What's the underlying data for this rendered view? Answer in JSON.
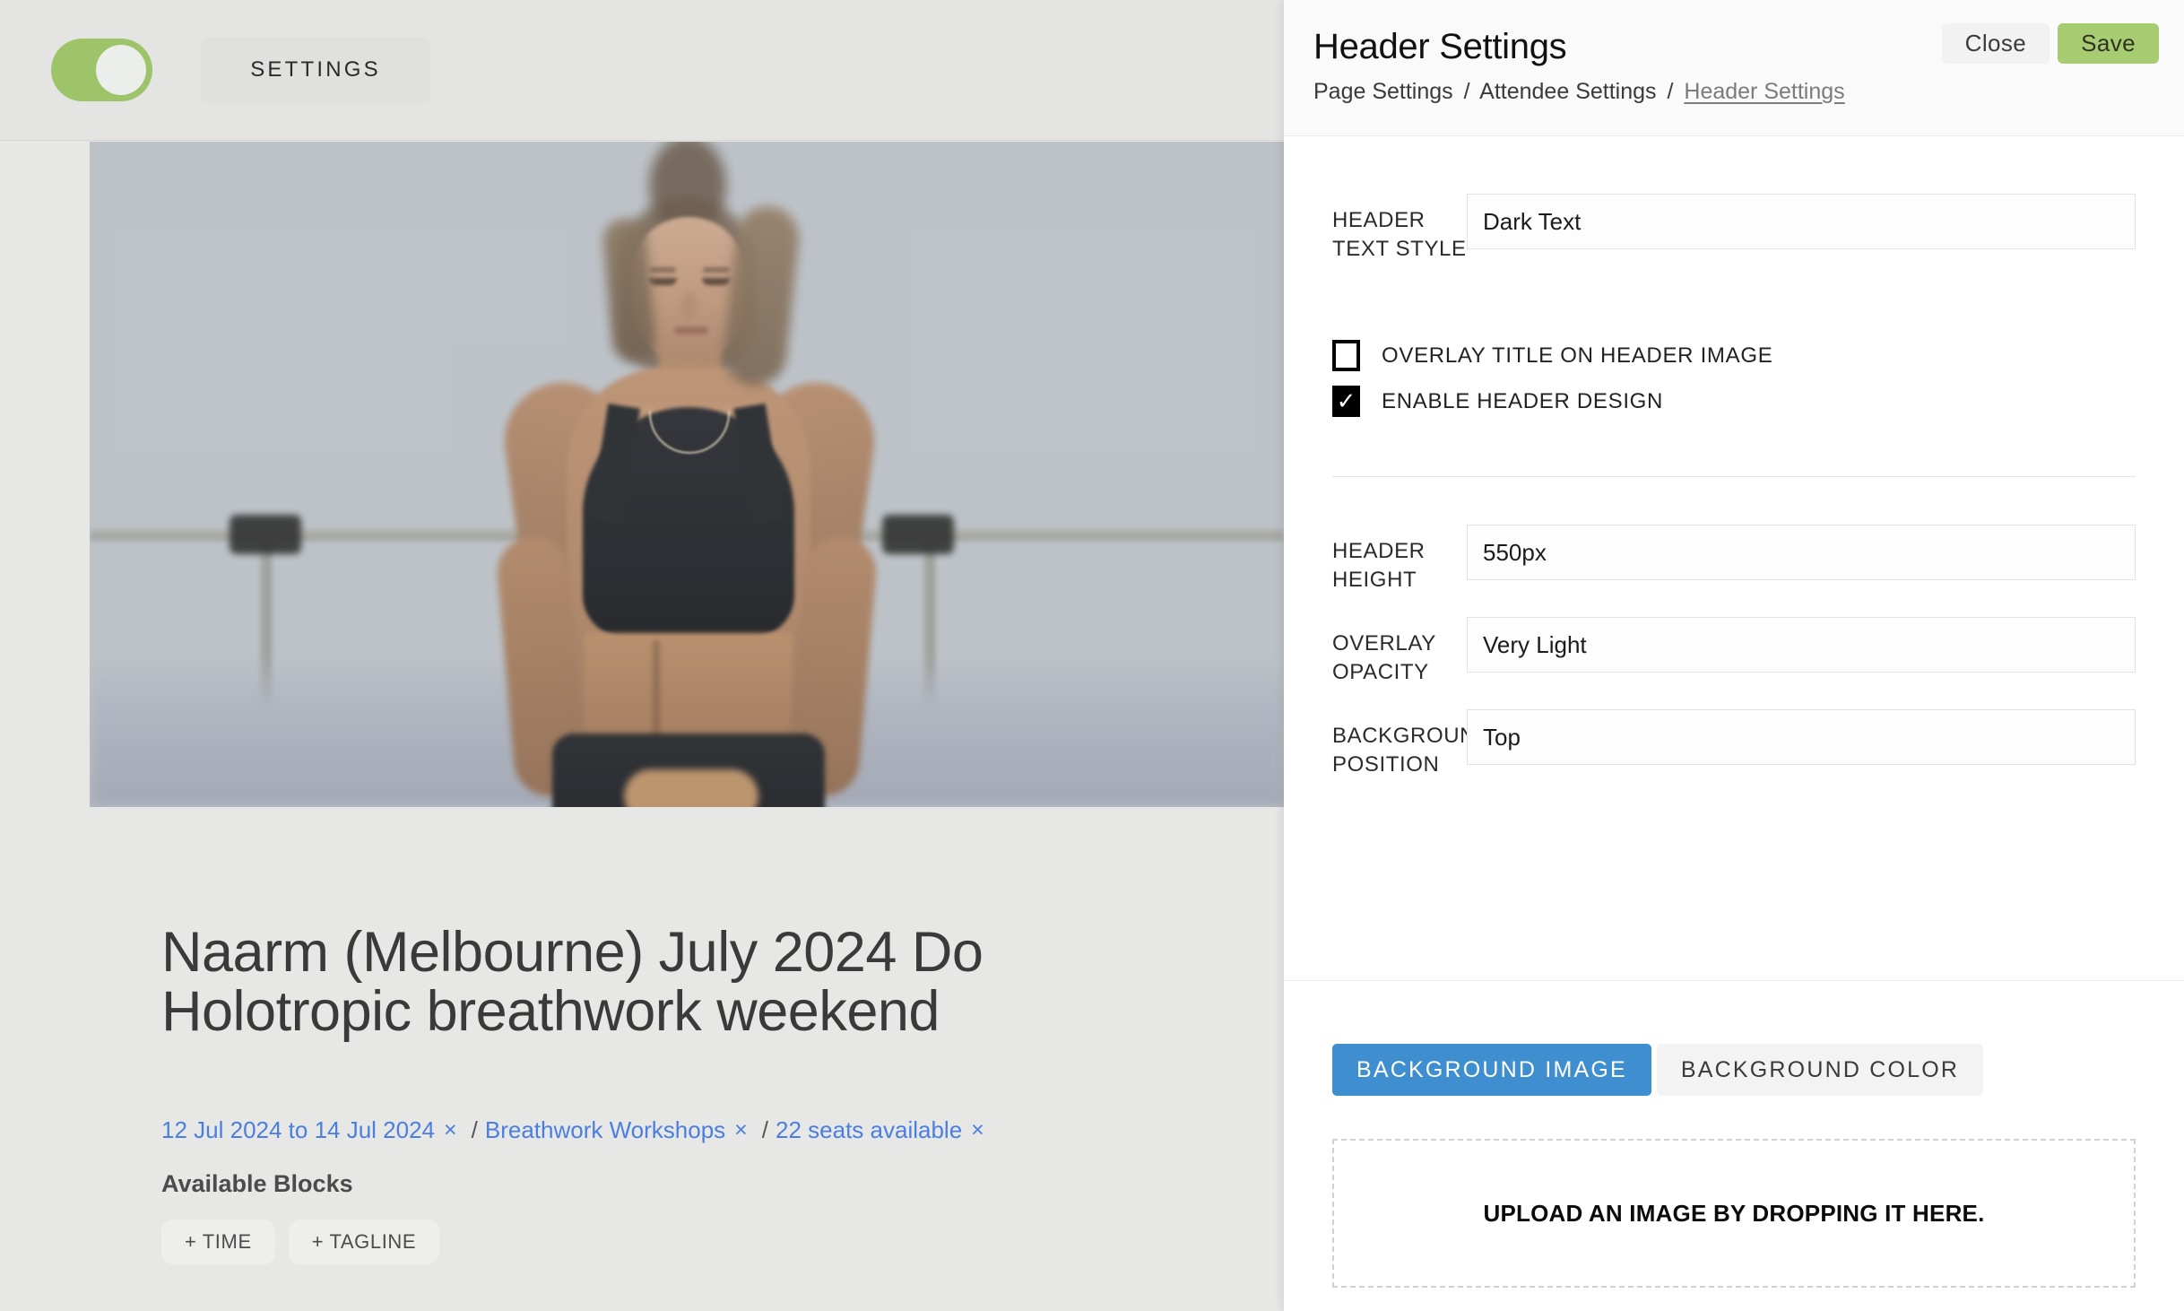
{
  "editor": {
    "toolbar": {
      "toggle_name": "preview-toggle",
      "toggle_on": true,
      "settings_label": "SETTINGS"
    },
    "hero": {
      "alt": "woman meditating cross-legged in a bright studio with blurred foliage"
    },
    "page_title": "Naarm (Melbourne) July 2024 Do\nHolotropic breathwork weekend",
    "meta": {
      "items": [
        {
          "label": "12 Jul 2024 to 14 Jul 2024",
          "remove": "×"
        },
        {
          "label": "Breathwork Workshops",
          "remove": "×"
        },
        {
          "label": "22 seats available",
          "remove": "×"
        }
      ],
      "separator": "/"
    },
    "blocks": {
      "heading": "Available Blocks",
      "chips": [
        {
          "label": "+ TIME"
        },
        {
          "label": "+ TAGLINE"
        }
      ]
    }
  },
  "panel": {
    "title": "Header Settings",
    "breadcrumb": {
      "items": [
        "Page Settings",
        "Attendee Settings",
        "Header Settings"
      ],
      "separator": "/",
      "active_index": 2
    },
    "actions": {
      "close_label": "Close",
      "save_label": "Save"
    },
    "fields": [
      {
        "label": "HEADER\nTEXT STYLE",
        "value": "Dark Text"
      },
      {
        "label": "HEADER\nHEIGHT",
        "value": "550px"
      },
      {
        "label": "OVERLAY\nOPACITY",
        "value": "Very Light"
      },
      {
        "label": "BACKGROUND\nPOSITION",
        "value": "Top"
      }
    ],
    "checkboxes": [
      {
        "label": "OVERLAY TITLE ON HEADER IMAGE",
        "checked": false,
        "tick": "✓"
      },
      {
        "label": "ENABLE HEADER DESIGN",
        "checked": true,
        "tick": "✓"
      }
    ],
    "background_tabs": [
      {
        "label": "BACKGROUND IMAGE",
        "active": true
      },
      {
        "label": "BACKGROUND COLOR",
        "active": false
      }
    ],
    "dropzone_label": "UPLOAD AN IMAGE BY DROPPING IT HERE."
  },
  "colors": {
    "toggle_green": "#9ec46a",
    "save_green": "#a8cc72",
    "tab_blue": "#3f8fd0",
    "link_blue": "#4a7fe0",
    "editor_bg": "#e7e7e6",
    "panel_bg": "#ffffff"
  }
}
